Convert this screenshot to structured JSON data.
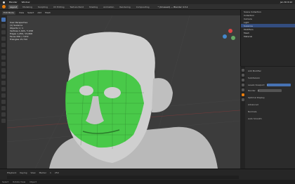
{
  "menubar": {
    "app": "Blender",
    "menu": "Window",
    "right": "Jan 30 8:42"
  },
  "topbar": {
    "tabs": [
      "Layout",
      "Modeling",
      "Sculpting",
      "UV Editing",
      "Texture Paint",
      "Shading",
      "Animation",
      "Rendering",
      "Compositing",
      "Geometry Nodes",
      "Scripting"
    ],
    "active_tab": 0,
    "title": "* (Unsaved) — Blender 4.3.2"
  },
  "viewport_header": {
    "mode": "Edit Mode",
    "view": "View",
    "select": "Select",
    "add": "Add",
    "mesh": "Mesh"
  },
  "stats": [
    "User Perspective",
    "(1) Suzanne",
    "Objects  1 / 1",
    "Vertices  1,024 / 7,958",
    "Edges  1,456 / 15,808",
    "Faces  456 / 7,872",
    "Triangles  15,744"
  ],
  "outliner": [
    "Scene Collection",
    "Collection",
    "Camera",
    "Light",
    "Suzanne",
    "Modifiers",
    "Mesh",
    "Material"
  ],
  "properties": {
    "labels": [
      "Add Modifier",
      "Subdivision",
      "Levels Viewport",
      "Render",
      "Optimal Display",
      "Advanced",
      "Normals",
      "Auto Smooth"
    ],
    "values": [
      "1",
      "2"
    ]
  },
  "timeline": {
    "items": [
      "Playback",
      "Keying",
      "View",
      "Marker"
    ],
    "start": "1",
    "end": "250"
  },
  "statusbar": [
    "Select",
    "Rotate View",
    "Object"
  ]
}
